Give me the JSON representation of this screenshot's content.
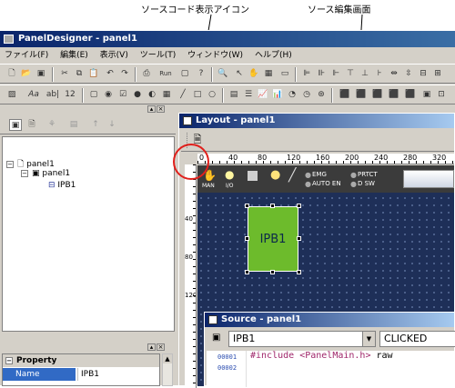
{
  "callouts": {
    "source_icon": "ソースコード表示アイコン",
    "source_editor": "ソース編集画面"
  },
  "app": {
    "title": "PanelDesigner - panel1",
    "menu": [
      "ファイル(F)",
      "編集(E)",
      "表示(V)",
      "ツール(T)",
      "ウィンドウ(W)",
      "ヘルプ(H)"
    ],
    "toolbar_text": {
      "run": "Run",
      "aa": "Aa",
      "ab": "ab|",
      "num": "12"
    }
  },
  "tree": {
    "root": "panel1",
    "child": "panel1",
    "leaf": "IPB1",
    "expand_minus": "−"
  },
  "property": {
    "title": "Property",
    "row_name_label": "Name",
    "row_name_value": "IPB1"
  },
  "layout_window": {
    "title": "Layout - panel1",
    "ruler_x": [
      "0",
      "40",
      "80",
      "120",
      "160",
      "200",
      "240",
      "280",
      "320"
    ],
    "ruler_y": [
      "40",
      "80",
      "120"
    ],
    "tools": {
      "man": "MAN",
      "io": "I/O",
      "emg": "EMG",
      "auto_en": "AUTO EN",
      "prtct": "PRTCT",
      "dsw": "D SW"
    },
    "button_label": "IPB1",
    "button_color": "#6dbb2c"
  },
  "source_window": {
    "title": "Source - panel1",
    "object_select": "IPB1",
    "event_select": "CLICKED",
    "lines": [
      {
        "num": "00001",
        "keyword": "#include",
        "header": "<PanelMain.h>",
        "rest": "raw"
      },
      {
        "num": "00002"
      }
    ]
  },
  "colors": {
    "title_blue": "#0a246a",
    "highlight_red": "#e0201c"
  }
}
